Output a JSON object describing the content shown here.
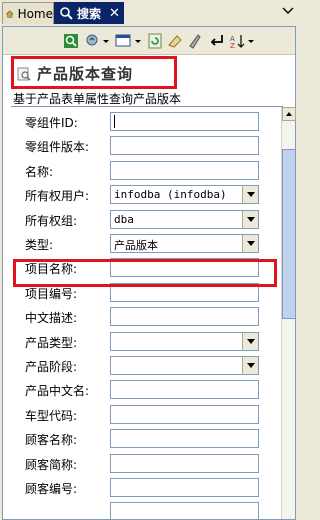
{
  "tabs": [
    {
      "label": "Home",
      "icon": "home-icon"
    },
    {
      "label": "搜索",
      "icon": "search-icon"
    }
  ],
  "toolbar": {
    "icons": [
      "run-query-icon",
      "search-options-icon",
      "dropdown-icon",
      "view-icon",
      "dropdown-icon",
      "refresh-icon",
      "clear-icon",
      "print-icon",
      "enter-icon",
      "sort-icon",
      "dropdown-icon"
    ]
  },
  "page": {
    "title": "产品版本查询",
    "subtitle": "基于产品表单属性查询产品版本"
  },
  "form": {
    "fields": [
      {
        "label": "零组件ID:",
        "type": "text",
        "value": ""
      },
      {
        "label": "零组件版本:",
        "type": "text",
        "value": ""
      },
      {
        "label": "名称:",
        "type": "text",
        "value": ""
      },
      {
        "label": "所有权用户:",
        "type": "select",
        "value": "infodba (infodba)"
      },
      {
        "label": "所有权组:",
        "type": "select",
        "value": "dba"
      },
      {
        "label": "类型:",
        "type": "select",
        "value": "产品版本"
      },
      {
        "label": "项目名称:",
        "type": "text",
        "value": ""
      },
      {
        "label": "项目编号:",
        "type": "text",
        "value": ""
      },
      {
        "label": "中文描述:",
        "type": "text",
        "value": ""
      },
      {
        "label": "产品类型:",
        "type": "select",
        "value": ""
      },
      {
        "label": "产品阶段:",
        "type": "select",
        "value": ""
      },
      {
        "label": "产品中文名:",
        "type": "text",
        "value": ""
      },
      {
        "label": "车型代码:",
        "type": "text",
        "value": ""
      },
      {
        "label": "顾客名称:",
        "type": "text",
        "value": ""
      },
      {
        "label": "顾客简称:",
        "type": "text",
        "value": ""
      },
      {
        "label": "顾客编号:",
        "type": "text",
        "value": ""
      },
      {
        "label": "",
        "type": "text",
        "value": ""
      }
    ]
  },
  "colors": {
    "highlight": "#e0141e",
    "active_tab": "#0a246a"
  }
}
